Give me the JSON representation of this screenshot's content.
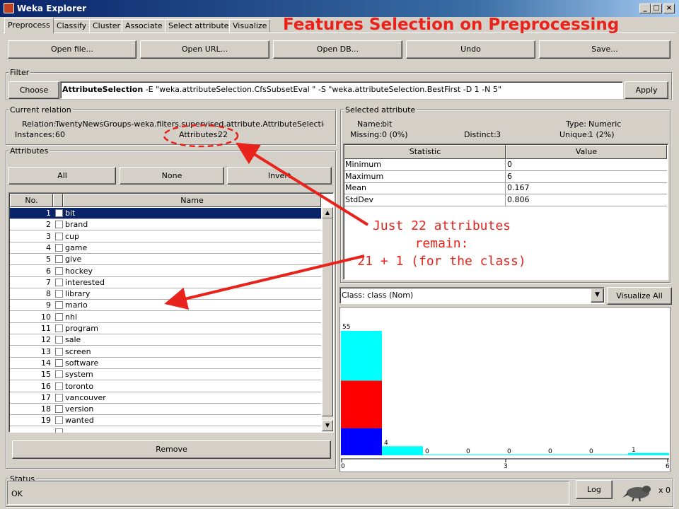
{
  "window": {
    "title": "Weka Explorer"
  },
  "heading": "Features Selection on Preprocessing",
  "tabs": [
    {
      "label": "Preprocess",
      "active": true
    },
    {
      "label": "Classify"
    },
    {
      "label": "Cluster"
    },
    {
      "label": "Associate"
    },
    {
      "label": "Select attributes"
    },
    {
      "label": "Visualize"
    }
  ],
  "toolbar": {
    "open_file": "Open file...",
    "open_url": "Open URL...",
    "open_db": "Open DB...",
    "undo": "Undo",
    "save": "Save..."
  },
  "filter": {
    "group_label": "Filter",
    "choose": "Choose",
    "name": "AttributeSelection",
    "options": " -E \"weka.attributeSelection.CfsSubsetEval \" -S \"weka.attributeSelection.BestFirst -D 1 -N 5\"",
    "apply": "Apply"
  },
  "relation": {
    "group_label": "Current relation",
    "relation_label": "Relation:",
    "relation_value": "TwentyNewsGroups-weka.filters.supervised.attribute.AttributeSelection-E...",
    "instances_label": "Instances:",
    "instances_value": "60",
    "attributes_label": "Attributes:",
    "attributes_value": "22"
  },
  "attributes": {
    "group_label": "Attributes",
    "all": "All",
    "none": "None",
    "invert": "Invert",
    "col_no": "No.",
    "col_name": "Name",
    "rows": [
      {
        "no": "1",
        "name": "bit"
      },
      {
        "no": "2",
        "name": "brand"
      },
      {
        "no": "3",
        "name": "cup"
      },
      {
        "no": "4",
        "name": "game"
      },
      {
        "no": "5",
        "name": "give"
      },
      {
        "no": "6",
        "name": "hockey"
      },
      {
        "no": "7",
        "name": "interested"
      },
      {
        "no": "8",
        "name": "library"
      },
      {
        "no": "9",
        "name": "mario"
      },
      {
        "no": "10",
        "name": "nhl"
      },
      {
        "no": "11",
        "name": "program"
      },
      {
        "no": "12",
        "name": "sale"
      },
      {
        "no": "13",
        "name": "screen"
      },
      {
        "no": "14",
        "name": "software"
      },
      {
        "no": "15",
        "name": "system"
      },
      {
        "no": "16",
        "name": "toronto"
      },
      {
        "no": "17",
        "name": "vancouver"
      },
      {
        "no": "18",
        "name": "version"
      },
      {
        "no": "19",
        "name": "wanted"
      }
    ],
    "remove": "Remove"
  },
  "selected": {
    "group_label": "Selected attribute",
    "name_label": "Name:",
    "name_value": "bit",
    "type_label": "Type:",
    "type_value": "Numeric",
    "missing_label": "Missing:",
    "missing_value": "0 (0%)",
    "distinct_label": "Distinct:",
    "distinct_value": "3",
    "unique_label": "Unique:",
    "unique_value": "1 (2%)",
    "col_stat": "Statistic",
    "col_value": "Value",
    "stats": [
      {
        "stat": "Minimum",
        "value": "0"
      },
      {
        "stat": "Maximum",
        "value": "6"
      },
      {
        "stat": "Mean",
        "value": "0.167"
      },
      {
        "stat": "StdDev",
        "value": "0.806"
      }
    ]
  },
  "class_select": {
    "value": "Class: class (Nom)",
    "visualize_all": "Visualize All"
  },
  "callout": {
    "line1": "Just 22 attributes",
    "line2": "remain:",
    "line3": "21 + 1 (for the class)"
  },
  "histogram": {
    "x_ticks": [
      "0",
      "3",
      "6"
    ],
    "bar_labels": [
      "55",
      "4",
      "0",
      "0",
      "0",
      "0",
      "0",
      "1"
    ],
    "counts": [
      55,
      4,
      0,
      0,
      0,
      0,
      0,
      1
    ],
    "stack_first": [
      12,
      21,
      22
    ],
    "colors": {
      "cyan": "#00ffff",
      "red": "#ff0000",
      "blue": "#0000ff"
    }
  },
  "status": {
    "group_label": "Status",
    "text": "OK",
    "log": "Log",
    "count": "x 0"
  },
  "colors": {
    "accent_red": "#e8231c",
    "selection": "#0a246a"
  }
}
